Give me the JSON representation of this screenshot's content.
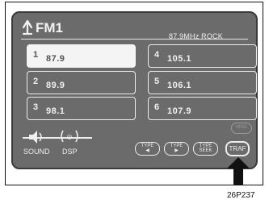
{
  "header": {
    "band": "FM1",
    "station_info": "87.9MHz ROCK"
  },
  "presets": [
    {
      "num": "1",
      "freq": "87.9",
      "selected": true
    },
    {
      "num": "2",
      "freq": "89.9",
      "selected": false
    },
    {
      "num": "3",
      "freq": "98.1",
      "selected": false
    },
    {
      "num": "4",
      "freq": "105.1",
      "selected": false
    },
    {
      "num": "5",
      "freq": "106.1",
      "selected": false
    },
    {
      "num": "6",
      "freq": "107.9",
      "selected": false
    }
  ],
  "bottom": {
    "sound_label": "SOUND",
    "dsp_label": "DSP",
    "type_prev_line1": "TYPE",
    "type_next_line1": "TYPE",
    "type_seek_line1": "TYPE",
    "type_seek_line2": "SEEK",
    "traf_label": "TRAF",
    "msg_label": "MSG"
  },
  "figure_code": "26P237"
}
